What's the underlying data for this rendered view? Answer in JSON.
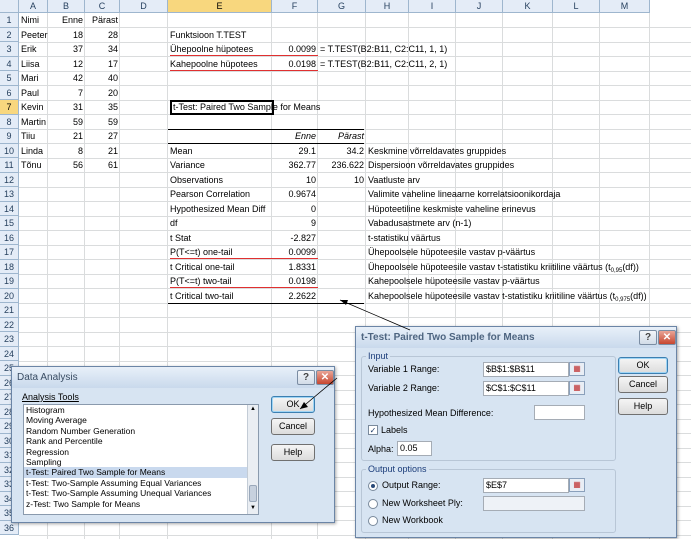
{
  "columns": [
    "A",
    "B",
    "C",
    "D",
    "E",
    "F",
    "G",
    "H",
    "I",
    "J",
    "K",
    "L",
    "M"
  ],
  "rows": [
    "1",
    "2",
    "3",
    "4",
    "5",
    "6",
    "7",
    "8",
    "9",
    "10",
    "11",
    "12",
    "13",
    "14",
    "15",
    "16",
    "17",
    "18",
    "19",
    "20",
    "21",
    "22",
    "23",
    "24",
    "25",
    "26",
    "27",
    "28",
    "29",
    "30",
    "31",
    "32",
    "33",
    "34",
    "35",
    "36"
  ],
  "data_table": {
    "headers": [
      "Nimi",
      "Enne",
      "Pärast"
    ],
    "rows": [
      [
        "Peeter",
        "18",
        "28"
      ],
      [
        "Erik",
        "37",
        "34"
      ],
      [
        "Liisa",
        "12",
        "17"
      ],
      [
        "Mari",
        "42",
        "40"
      ],
      [
        "Paul",
        "7",
        "20"
      ],
      [
        "Kevin",
        "31",
        "35"
      ],
      [
        "Martin",
        "59",
        "59"
      ],
      [
        "Tiiu",
        "21",
        "27"
      ],
      [
        "Linda",
        "8",
        "21"
      ],
      [
        "Tõnu",
        "56",
        "61"
      ]
    ]
  },
  "ttest_func": {
    "title": "Funktsioon T.TEST",
    "one_label": "Ühepoolne hüpotees",
    "one_value": "0.0099",
    "one_formula": "= T.TEST(B2:B11, C2:C11, 1, 1)",
    "two_label": "Kahepoolne hüpotees",
    "two_value": "0.0198",
    "two_formula": "= T.TEST(B2:B11, C2:C11, 2, 1)"
  },
  "results": {
    "title": "t-Test: Paired Two Sample for Means",
    "col_enne": "Enne",
    "col_parast": "Pärast",
    "rows": [
      {
        "label": "Mean",
        "enne": "29.1",
        "parast": "34.2",
        "note": "Keskmine võrreldavates gruppides"
      },
      {
        "label": "Variance",
        "enne": "362.77",
        "parast": "236.622",
        "note": "Dispersioon võrreldavates gruppides"
      },
      {
        "label": "Observations",
        "enne": "10",
        "parast": "10",
        "note": "Vaatluste arv"
      },
      {
        "label": "Pearson Correlation",
        "enne": "0.9674",
        "parast": "",
        "note": "Valimite vaheline lineaarne korrelatsioonikordaja"
      },
      {
        "label": "Hypothesized Mean Diff",
        "enne": "0",
        "parast": "",
        "note": "Hüpoteetiline keskmiste vaheline erinevus"
      },
      {
        "label": "df",
        "enne": "9",
        "parast": "",
        "note": "Vabadusastmete arv (n-1)"
      },
      {
        "label": "t Stat",
        "enne": "-2.827",
        "parast": "",
        "note": "t-statistiku väärtus"
      },
      {
        "label": "P(T<=t) one-tail",
        "enne": "0.0099",
        "parast": "",
        "note": "Ühepoolsele hüpoteesile vastav p-väärtus"
      },
      {
        "label": "t Critical one-tail",
        "enne": "1.8331",
        "parast": "",
        "note": "Ühepoolsele hüpoteesile vastav t-statistiku kriitiline väärtus (t",
        "sub": "0,95",
        "tail": "(df))"
      },
      {
        "label": "P(T<=t) two-tail",
        "enne": "0.0198",
        "parast": "",
        "note": "Kahepoolsele hüpoteesile vastav p-väärtus"
      },
      {
        "label": "t Critical two-tail",
        "enne": "2.2622",
        "parast": "",
        "note": "Kahepoolsele hüpoteesile vastav t-statistiku kriitiline väärtus (t",
        "sub": "0,975",
        "tail": "(df))"
      }
    ]
  },
  "data_analysis": {
    "title": "Data Analysis",
    "tools_label": "Analysis Tools",
    "items": [
      "Histogram",
      "Moving Average",
      "Random Number Generation",
      "Rank and Percentile",
      "Regression",
      "Sampling",
      "t-Test: Paired Two Sample for Means",
      "t-Test: Two-Sample Assuming Equal Variances",
      "t-Test: Two-Sample Assuming Unequal Variances",
      "z-Test: Two Sample for Means"
    ],
    "selected_index": 6,
    "ok": "OK",
    "cancel": "Cancel",
    "help": "Help"
  },
  "ttest_dialog": {
    "title": "t-Test: Paired Two Sample for Means",
    "input_group": "Input",
    "var1_label": "Variable 1 Range:",
    "var1_value": "$B$1:$B$11",
    "var2_label": "Variable 2 Range:",
    "var2_value": "$C$1:$C$11",
    "hmd_label": "Hypothesized Mean Difference:",
    "hmd_value": "",
    "labels_label": "Labels",
    "labels_checked": true,
    "alpha_label": "Alpha:",
    "alpha_value": "0.05",
    "output_group": "Output options",
    "output_range_label": "Output Range:",
    "output_range_value": "$E$7",
    "new_ws_label": "New Worksheet Ply:",
    "new_wb_label": "New Workbook",
    "ok": "OK",
    "cancel": "Cancel",
    "help": "Help"
  },
  "colors": {
    "header_bg": "#e4ecf7",
    "dialog_bg": "#d7e4f2",
    "red_underline": "#e03030",
    "selected_item": "#c9d9ee"
  }
}
